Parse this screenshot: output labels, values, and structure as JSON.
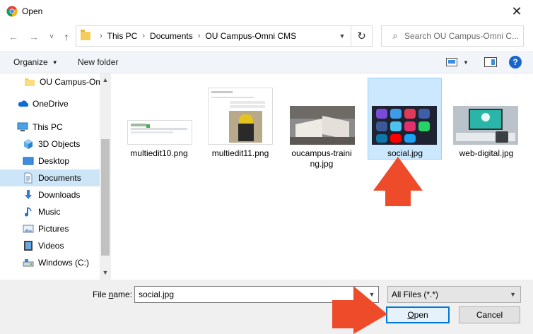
{
  "window": {
    "title": "Open",
    "close_glyph": "✕"
  },
  "nav": {
    "back_glyph": "←",
    "forward_glyph": "→",
    "recent_glyph": "˅",
    "up_glyph": "↑",
    "breadcrumbs": [
      "This PC",
      "Documents",
      "OU Campus-Omni CMS"
    ],
    "breadcrumb_sep": "›",
    "search_placeholder": "Search OU Campus-Omni C...",
    "refresh_glyph": "↻",
    "search_glyph": "⌕"
  },
  "toolbar": {
    "organize_label": "Organize",
    "new_folder_label": "New folder",
    "help_glyph": "?"
  },
  "sidebar": {
    "items": [
      {
        "label": "OU Campus-Om",
        "icon": "folder-icon"
      },
      {
        "label": "OneDrive",
        "icon": "onedrive-icon"
      },
      {
        "label": "This PC",
        "icon": "this-pc-icon"
      },
      {
        "label": "3D Objects",
        "icon": "3d-objects-icon"
      },
      {
        "label": "Desktop",
        "icon": "desktop-icon"
      },
      {
        "label": "Documents",
        "icon": "documents-icon",
        "selected": true
      },
      {
        "label": "Downloads",
        "icon": "downloads-icon"
      },
      {
        "label": "Music",
        "icon": "music-icon"
      },
      {
        "label": "Pictures",
        "icon": "pictures-icon"
      },
      {
        "label": "Videos",
        "icon": "videos-icon"
      },
      {
        "label": "Windows (C:)",
        "icon": "drive-icon"
      }
    ]
  },
  "files": [
    {
      "name": "multiedit10.png"
    },
    {
      "name": "multiedit11.png"
    },
    {
      "name_line1": "oucampus-traini",
      "name_line2": "ng.jpg"
    },
    {
      "name": "social.jpg",
      "selected": true
    },
    {
      "name": "web-digital.jpg"
    }
  ],
  "footer": {
    "file_name_label_pre": "File ",
    "file_name_label_ul": "n",
    "file_name_label_post": "ame:",
    "file_name_value": "social.jpg",
    "file_type_value": "All Files (*.*)",
    "open_label_ul": "O",
    "open_label_rest": "pen",
    "cancel_label": "Cancel"
  },
  "colors": {
    "accent": "#0078d7",
    "selection": "#cce8ff",
    "annotation_arrow": "#ee4b2b"
  }
}
